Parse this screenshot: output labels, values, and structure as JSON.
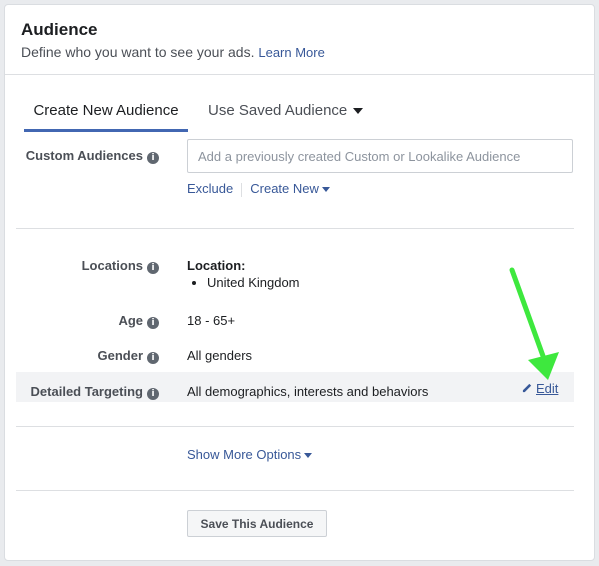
{
  "header": {
    "title": "Audience",
    "subtitle": "Define who you want to see your ads.",
    "learn_more": "Learn More"
  },
  "tabs": [
    {
      "label": "Create New Audience",
      "active": true
    },
    {
      "label": "Use Saved Audience",
      "active": false
    }
  ],
  "custom_audiences": {
    "label": "Custom Audiences",
    "placeholder": "Add a previously created Custom or Lookalike Audience",
    "exclude": "Exclude",
    "create_new": "Create New"
  },
  "locations": {
    "label": "Locations",
    "title": "Location:",
    "items": [
      "United Kingdom"
    ]
  },
  "age": {
    "label": "Age",
    "value": "18 - 65+"
  },
  "gender": {
    "label": "Gender",
    "value": "All genders"
  },
  "detailed_targeting": {
    "label": "Detailed Targeting",
    "value": "All demographics, interests and behaviors",
    "edit": "Edit"
  },
  "show_more": "Show More Options",
  "save_button": "Save This Audience",
  "colors": {
    "accent": "#4267b2",
    "link": "#385898",
    "annotation_arrow": "#3ee83e"
  },
  "icons": {
    "info": "info-icon",
    "dropdown": "caret-down-icon",
    "edit": "pencil-icon"
  }
}
